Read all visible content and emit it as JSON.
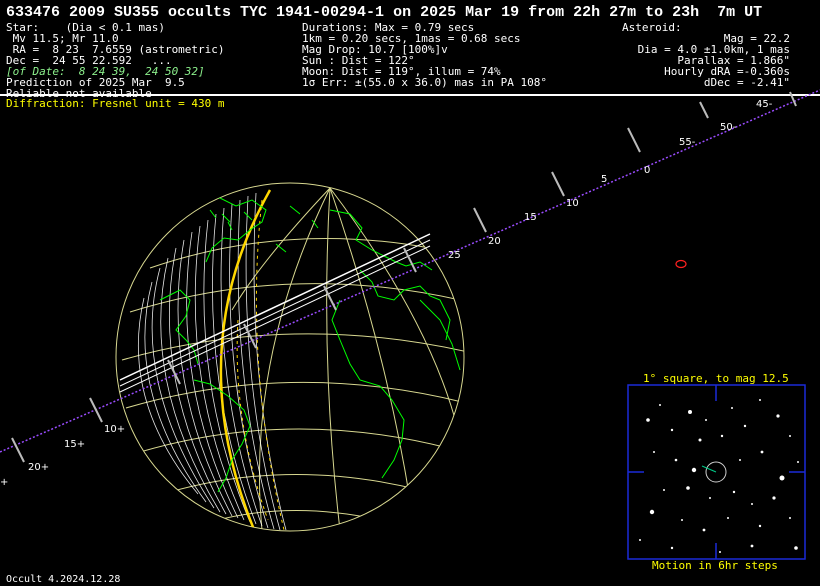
{
  "title": "633476 2009 SU355 occults TYC 1941-00294-1 on 2025 Mar 19 from 22h 27m to 23h  7m UT",
  "star": {
    "heading": "Star:    (Dia < 0.1 mas)",
    "mags": " Mv 11.5; Mr 11.0",
    "ra": " RA =  8 23  7.6559 (astrometric)",
    "dec": "Dec =  24 55 22.592   ...",
    "of_date": "[of Date:  8 24 39,  24 50 32]",
    "prediction": "Prediction of 2025 Mar  9.5",
    "reliable": "Reliable not available"
  },
  "event": {
    "durations": "Durations: Max = 0.79 secs",
    "scale": "1km = 0.20 secs, 1mas = 0.68 secs",
    "mag_drop": "Mag Drop: 10.7 [100%]v",
    "sun": "Sun : Dist = 122°",
    "moon": "Moon: Dist = 119°, illum = 74%",
    "error": "1σ Err: ±(55.0 x 36.0) mas in PA 108°"
  },
  "asteroid": {
    "heading": "Asteroid:",
    "mag": "Mag = 22.2",
    "dia": "Dia = 4.0 ±1.0km, 1 mas",
    "parallax": "Parallax = 1.866\"",
    "hourly_dra": "Hourly dRA =-0.360s",
    "ddec": "dDec = -2.41\""
  },
  "diffraction": "Diffraction: Fresnel unit = 430 m",
  "track_labels": [
    "20+",
    "15+",
    "10+",
    "25",
    "20",
    "15",
    "10",
    "5",
    "0",
    "55-",
    "50-",
    "45-",
    "+"
  ],
  "starchart": {
    "title": "1° square, to mag 12.5",
    "footer": "Motion in 6hr steps"
  },
  "version": "Occult 4.2024.12.28",
  "colors": {
    "background": "#000000",
    "graticule": "#d8d890",
    "coastline": "#00ff00",
    "path": "#ffffff",
    "limit_line": "#ffd700",
    "track": "#9a4cff",
    "chart_frame": "#1a2ad8",
    "label_yellow": "#ffff00"
  }
}
